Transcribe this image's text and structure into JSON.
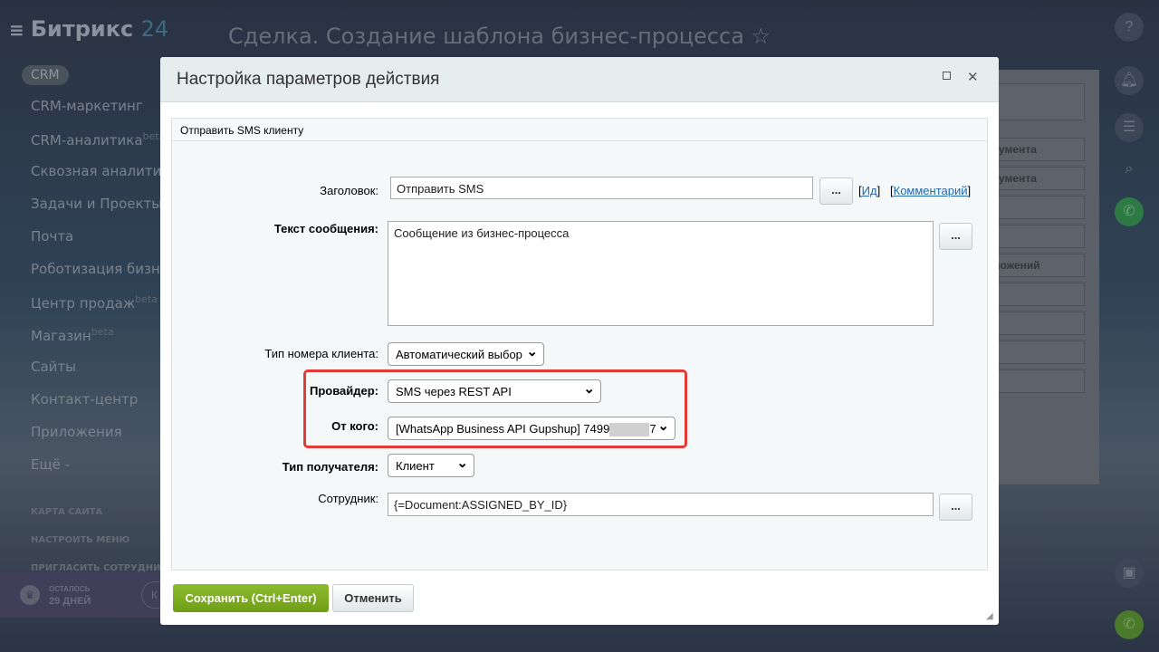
{
  "app": {
    "logo": "Битрикс",
    "logo_num": "24",
    "page_title": "Сделка. Создание шаблона бизнес-процесса"
  },
  "sidebar": {
    "active": "CRM",
    "items": [
      {
        "label": "CRM-маркетинг"
      },
      {
        "label": "CRM-аналитика",
        "sup": "beta"
      },
      {
        "label": "Сквозная аналитика"
      },
      {
        "label": "Задачи и Проекты"
      },
      {
        "label": "Почта"
      },
      {
        "label": "Роботизация бизнеса"
      },
      {
        "label": "Центр продаж",
        "sup": "beta"
      },
      {
        "label": "Магазин",
        "sup": "beta"
      },
      {
        "label": "Сайты"
      },
      {
        "label": "Контакт-центр"
      },
      {
        "label": "Приложения"
      },
      {
        "label": "Ещё -"
      }
    ],
    "footer": [
      "КАРТА САЙТА",
      "НАСТРОИТЬ МЕНЮ",
      "ПРИГЛАСИТЬ СОТРУДНИКОВ"
    ],
    "trial": {
      "label": "ОСТАЛОСЬ",
      "days": "29 ДНЕЙ",
      "button": "К"
    }
  },
  "background_panel": {
    "rows": [
      "",
      "",
      "кумента",
      "",
      "",
      "",
      "ложений",
      "",
      "",
      "",
      ""
    ]
  },
  "dialog": {
    "title": "Настройка параметров действия",
    "tab": "Отправить SMS клиенту",
    "fields": {
      "title_label": "Заголовок:",
      "title_value": "Отправить SMS",
      "id_link": "Ид",
      "comment_link": "Комментарий",
      "text_label": "Текст сообщения:",
      "text_value": "Сообщение из бизнес-процесса",
      "number_type_label": "Тип номера клиента:",
      "number_type_value": "Автоматический выбор",
      "provider_label": "Провайдер:",
      "provider_value": "SMS через REST API",
      "from_label": "От кого:",
      "from_value_prefix": "[WhatsApp Business API Gupshup] 7499",
      "from_value_suffix": "7",
      "recipient_type_label": "Тип получателя:",
      "recipient_type_value": "Клиент",
      "employee_label": "Сотрудник:",
      "employee_value": "{=Document:ASSIGNED_BY_ID}",
      "dots": "..."
    },
    "save": "Сохранить (Ctrl+Enter)",
    "cancel": "Отменить"
  },
  "colors": {
    "save_green": "#7aa91f",
    "highlight_red": "#e53935",
    "link": "#2067b0"
  }
}
